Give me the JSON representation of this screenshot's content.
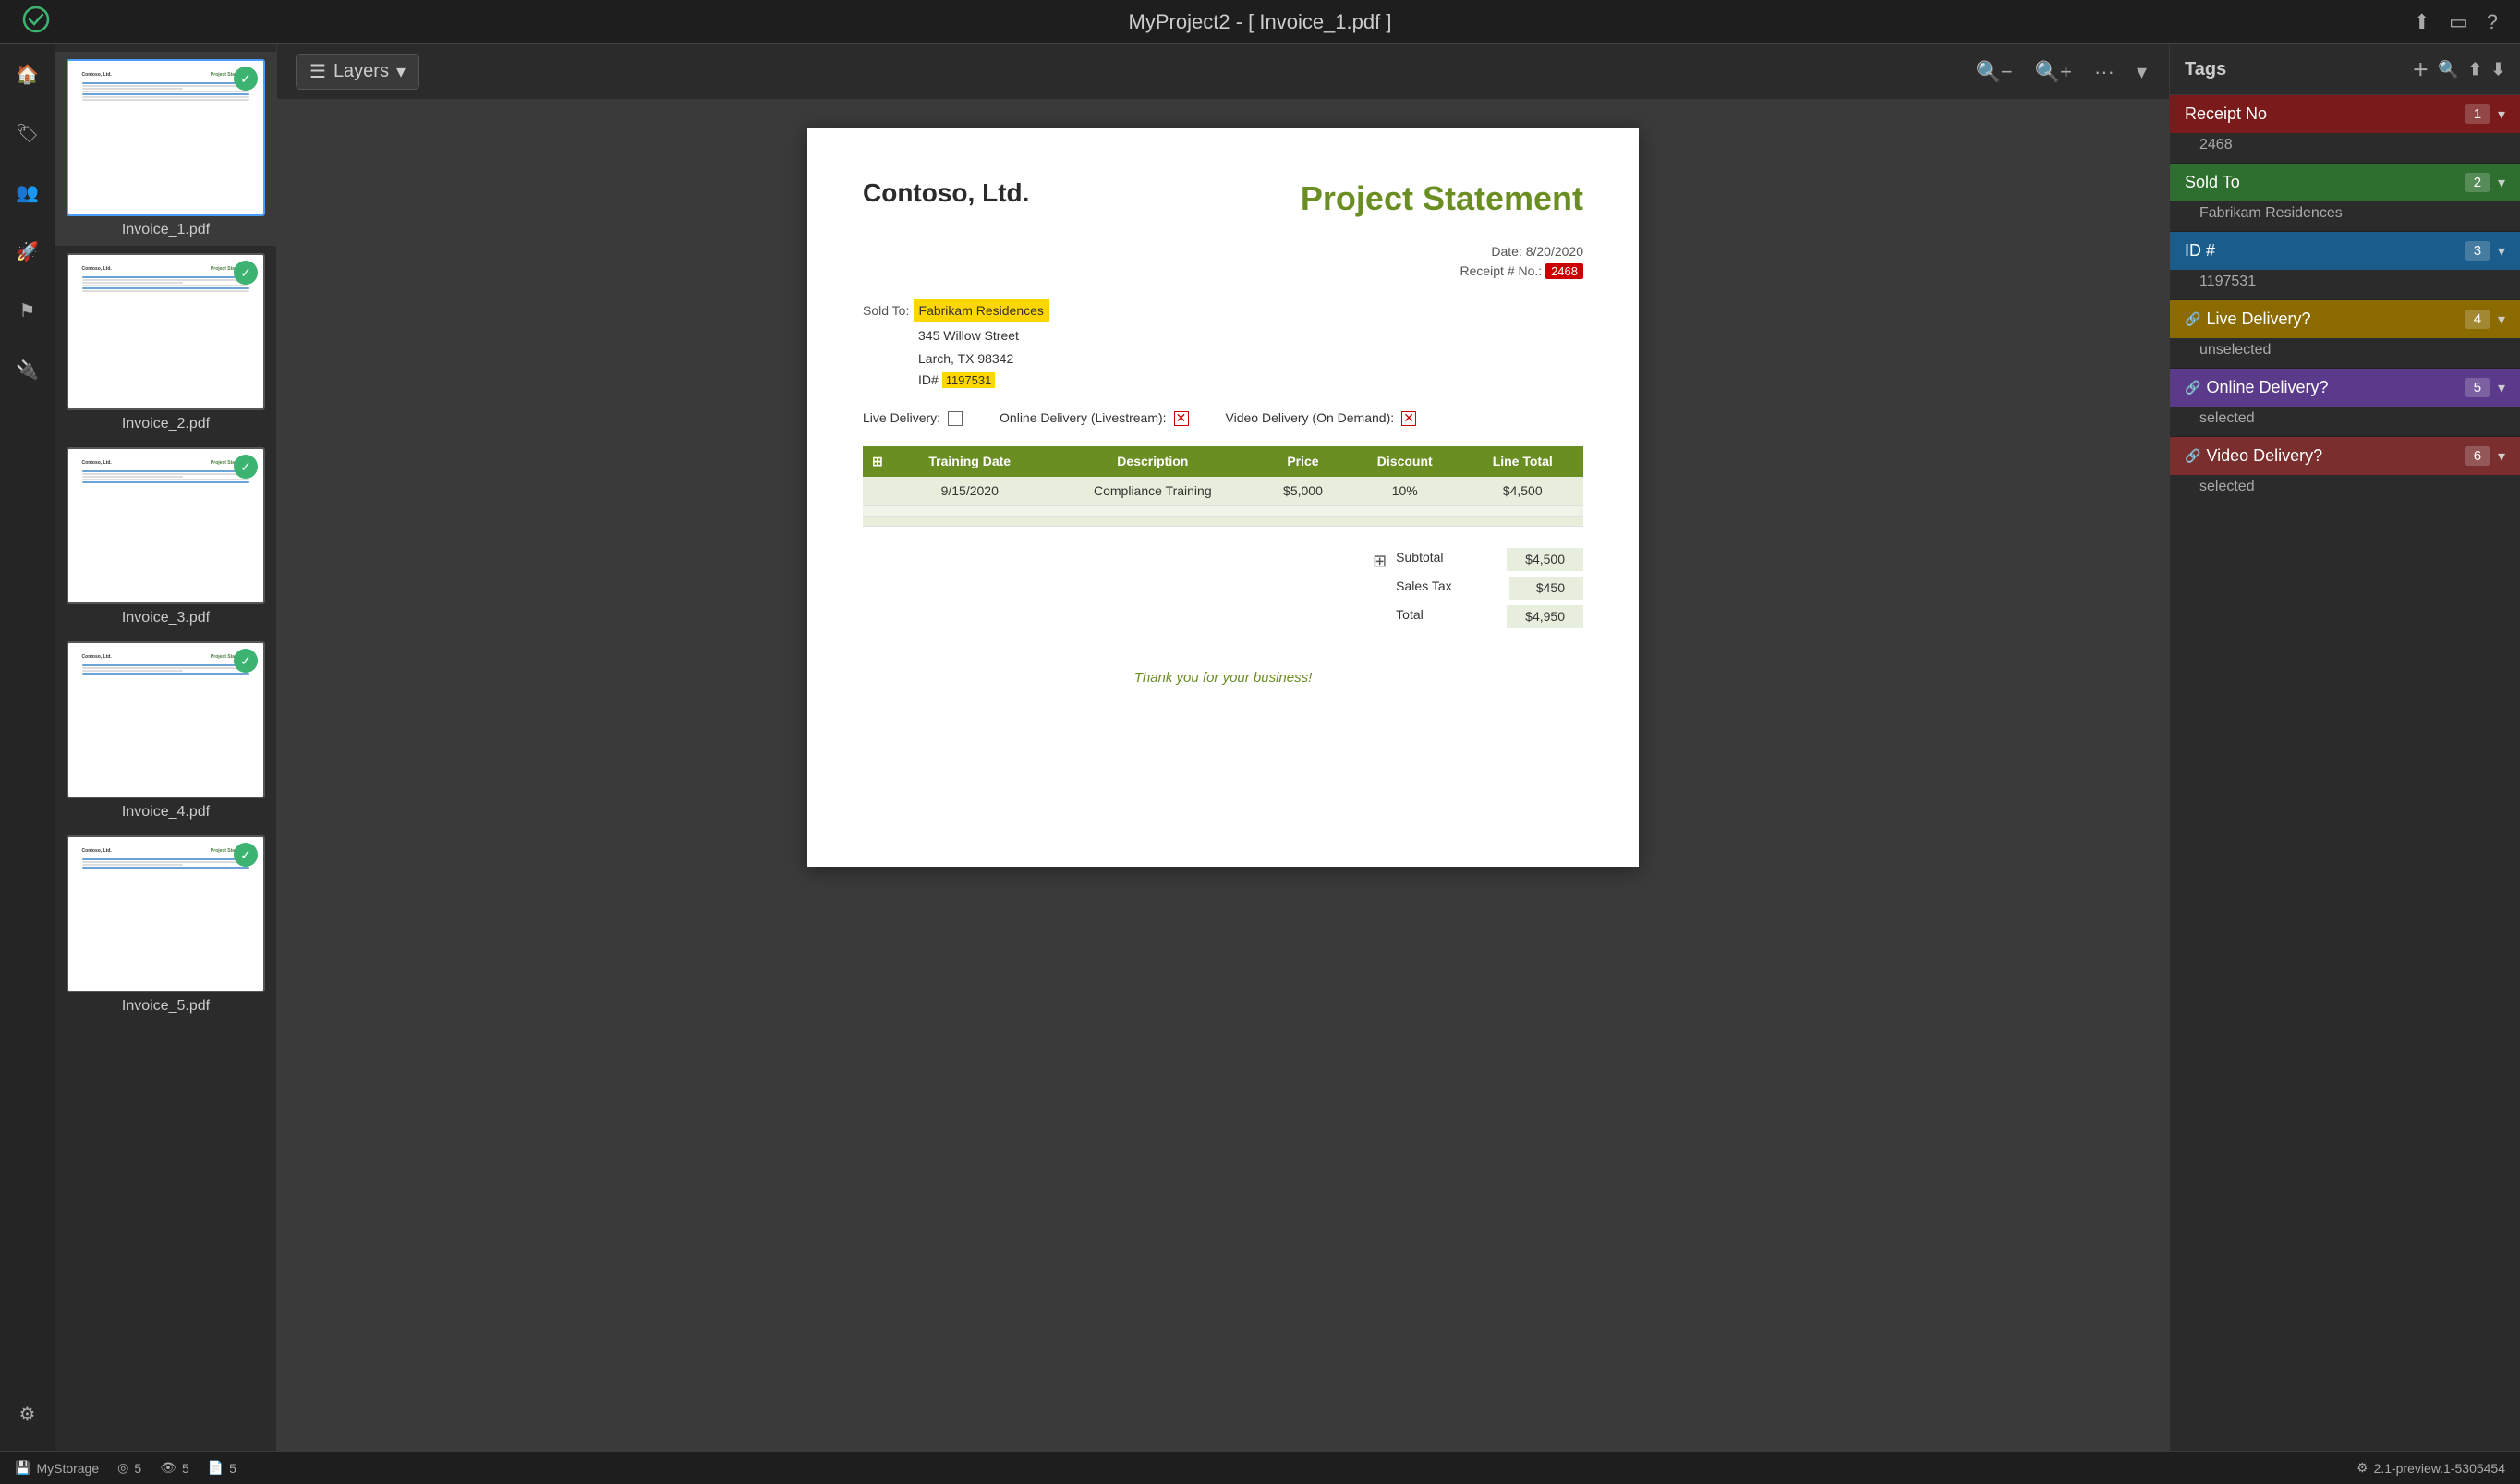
{
  "window": {
    "title": "MyProject2 - [ Invoice_1.pdf ]"
  },
  "toolbar": {
    "layers_label": "Layers",
    "zoom_out_label": "−",
    "zoom_in_label": "+",
    "more_label": "...",
    "chevron_label": "⌄"
  },
  "thumbnails": [
    {
      "id": 1,
      "label": "Invoice_1.pdf",
      "active": true,
      "has_badge": true
    },
    {
      "id": 2,
      "label": "Invoice_2.pdf",
      "active": false,
      "has_badge": true
    },
    {
      "id": 3,
      "label": "Invoice_3.pdf",
      "active": false,
      "has_badge": true
    },
    {
      "id": 4,
      "label": "Invoice_4.pdf",
      "active": false,
      "has_badge": true
    },
    {
      "id": 5,
      "label": "Invoice_5.pdf",
      "active": false,
      "has_badge": true
    }
  ],
  "invoice": {
    "company": "Contoso, Ltd.",
    "title": "Project Statement",
    "date_label": "Date:",
    "date_value": "8/20/2020",
    "receipt_label": "Receipt # No.:",
    "receipt_value": "2468",
    "sold_to_label": "Sold To:",
    "sold_to_value": "Fabrikam Residences",
    "address_line1": "345 Willow Street",
    "address_line2": "Larch, TX 98342",
    "id_label": "ID#",
    "id_value": "1197531",
    "live_delivery_label": "Live Delivery:",
    "online_delivery_label": "Online Delivery (Livestream):",
    "video_delivery_label": "Video Delivery (On Demand):",
    "table_headers": [
      "Training Date",
      "Description",
      "Price",
      "Discount",
      "Line Total"
    ],
    "table_rows": [
      {
        "date": "9/15/2020",
        "description": "Compliance Training",
        "price": "$5,000",
        "discount": "10%",
        "total": "$4,500"
      },
      {
        "date": "",
        "description": "",
        "price": "",
        "discount": "",
        "total": ""
      },
      {
        "date": "",
        "description": "",
        "price": "",
        "discount": "",
        "total": ""
      }
    ],
    "subtotal_label": "Subtotal",
    "subtotal_value": "$4,500",
    "sales_tax_label": "Sales Tax",
    "sales_tax_value": "$450",
    "total_label": "Total",
    "total_value": "$4,950",
    "thank_you": "Thank you for your business!"
  },
  "tags": {
    "header": "Tags",
    "items": [
      {
        "id": 1,
        "label": "Receipt No",
        "number": "1",
        "value": "2468",
        "color_class": "tag-receipt-no-bg",
        "expanded": true
      },
      {
        "id": 2,
        "label": "Sold To",
        "number": "2",
        "value": "Fabrikam Residences",
        "color_class": "tag-sold-to-bg",
        "expanded": true
      },
      {
        "id": 3,
        "label": "ID #",
        "number": "3",
        "value": "1197531",
        "color_class": "tag-id-bg",
        "expanded": true
      },
      {
        "id": 4,
        "label": "Live Delivery?",
        "number": "4",
        "value": "unselected",
        "color_class": "tag-live-delivery-bg",
        "has_link": true,
        "expanded": true
      },
      {
        "id": 5,
        "label": "Online Delivery?",
        "number": "5",
        "value": "selected",
        "color_class": "tag-online-delivery-bg",
        "has_link": true,
        "expanded": true
      },
      {
        "id": 6,
        "label": "Video Delivery?",
        "number": "6",
        "value": "selected",
        "color_class": "tag-video-delivery-bg",
        "has_link": true,
        "expanded": true
      }
    ]
  },
  "statusbar": {
    "storage_label": "MyStorage",
    "shapes_count": "5",
    "eyes_count": "5",
    "pages_count": "5",
    "version": "2.1-preview.1-5305454"
  }
}
